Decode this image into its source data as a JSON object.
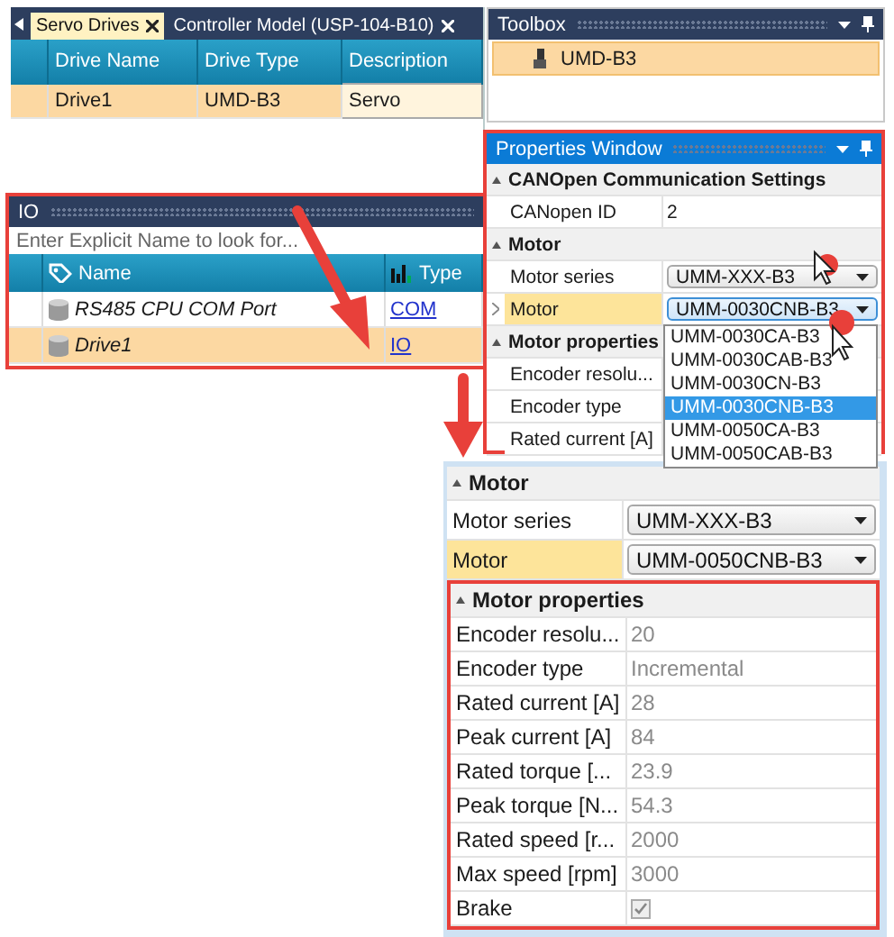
{
  "servo_drives_panel": {
    "tabs": [
      {
        "label": "Servo Drives",
        "selected": true
      },
      {
        "label": "Controller Model (USP-104-B10)",
        "selected": false
      }
    ],
    "columns": [
      "Drive Name",
      "Drive Type",
      "Description"
    ],
    "rows": [
      {
        "cells": [
          "Drive1",
          "UMD-B3",
          "Servo"
        ],
        "selected": true
      }
    ]
  },
  "io_panel": {
    "title": "IO",
    "search": {
      "placeholder": "Enter Explicit Name to look for..."
    },
    "columns": [
      "Name",
      "Type"
    ],
    "rows": [
      {
        "name": "RS485 CPU COM Port",
        "type": "COM",
        "selected": false
      },
      {
        "name": "Drive1",
        "type": "IO",
        "selected": true
      }
    ]
  },
  "toolbox": {
    "title": "Toolbox",
    "items": [
      {
        "label": "UMD-B3",
        "selected": true
      }
    ]
  },
  "properties_window": {
    "title": "Properties Window",
    "rows": [
      {
        "kind": "category",
        "label": "CANOpen Communication Settings"
      },
      {
        "kind": "text",
        "label": "CANopen ID",
        "value": "2"
      },
      {
        "kind": "category",
        "label": "Motor"
      },
      {
        "kind": "dropdown",
        "label": "Motor series",
        "value": "UMM-XXX-B3",
        "selected": false
      },
      {
        "kind": "dropdown",
        "label": "Motor",
        "value": "UMM-0030CNB-B3",
        "selected": true,
        "options": [
          {
            "label": "UMM-0030CA-B3",
            "selected": false
          },
          {
            "label": "UMM-0030CAB-B3",
            "selected": false
          },
          {
            "label": "UMM-0030CN-B3",
            "selected": false
          },
          {
            "label": "UMM-0030CNB-B3",
            "selected": true
          },
          {
            "label": "UMM-0050CA-B3",
            "selected": false
          },
          {
            "label": "UMM-0050CAB-B3",
            "selected": false
          }
        ]
      },
      {
        "kind": "category",
        "label": "Motor properties"
      },
      {
        "kind": "text",
        "label": "Encoder resolu..."
      },
      {
        "kind": "text",
        "label": "Encoder type"
      },
      {
        "kind": "text",
        "label": "Rated current [A]"
      }
    ]
  },
  "detail_panel": {
    "rows": [
      {
        "kind": "category",
        "label": "Motor"
      },
      {
        "kind": "dropdown",
        "label": "Motor series",
        "value": "UMM-XXX-B3",
        "selected": false
      },
      {
        "kind": "dropdown",
        "label": "Motor",
        "value": "UMM-0050CNB-B3",
        "selected": true
      },
      {
        "kind": "category",
        "label": "Motor properties",
        "highlighted": true
      },
      {
        "kind": "text",
        "label": "Encoder resolu...",
        "value": "20",
        "readonly": true
      },
      {
        "kind": "text",
        "label": "Encoder type",
        "value": "Incremental",
        "readonly": true
      },
      {
        "kind": "text",
        "label": "Rated current [A]",
        "value": "28",
        "readonly": true
      },
      {
        "kind": "text",
        "label": "Peak current [A]",
        "value": "84",
        "readonly": true
      },
      {
        "kind": "text",
        "label": "Rated torque [...",
        "value": "23.9",
        "readonly": true
      },
      {
        "kind": "text",
        "label": "Peak torque [N...",
        "value": "54.3",
        "readonly": true
      },
      {
        "kind": "text",
        "label": "Rated speed [r...",
        "value": "2000",
        "readonly": true
      },
      {
        "kind": "text",
        "label": "Max speed [rpm]",
        "value": "3000",
        "readonly": true
      },
      {
        "kind": "checkbox",
        "label": "Brake",
        "checked": true,
        "readonly": true
      }
    ]
  }
}
